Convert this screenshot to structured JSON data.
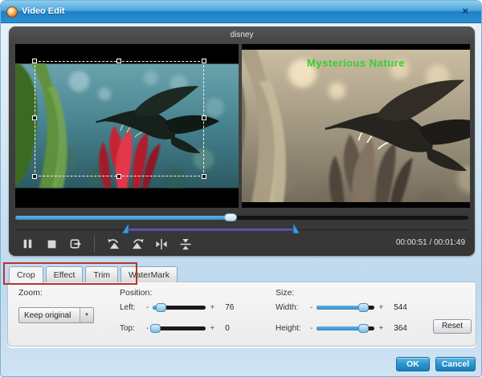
{
  "window": {
    "title": "Video Edit",
    "close_glyph": "×"
  },
  "stage": {
    "clip_name": "disney",
    "time_display": "00:00:51 / 00:01:49",
    "watermark_text": "Mysterious Nature"
  },
  "icons": {
    "app": "video-edit-app-icon",
    "pause": "pause-icon",
    "stop": "stop-icon",
    "snapshot": "snapshot-icon",
    "rotate_left": "rotate-left-icon",
    "rotate_right": "rotate-right-icon",
    "flip_horizontal": "flip-horizontal-icon",
    "flip_vertical": "flip-vertical-icon",
    "dropdown_arrow": "▼"
  },
  "tabs": {
    "items": [
      {
        "label": "Crop",
        "active": true
      },
      {
        "label": "Effect",
        "active": false
      },
      {
        "label": "Trim",
        "active": false
      },
      {
        "label": "WaterMark",
        "active": false
      }
    ]
  },
  "controls": {
    "zoom": {
      "label": "Zoom:",
      "selected": "Keep original"
    },
    "position": {
      "label": "Position:",
      "left": {
        "label": "Left:",
        "minus": "-",
        "plus": "+",
        "value": "76"
      },
      "top": {
        "label": "Top:",
        "minus": "-",
        "plus": "+",
        "value": "0"
      }
    },
    "size": {
      "label": "Size:",
      "width": {
        "label": "Width:",
        "minus": "-",
        "plus": "+",
        "value": "544"
      },
      "height": {
        "label": "Height:",
        "minus": "-",
        "plus": "+",
        "value": "364"
      }
    },
    "reset_label": "Reset"
  },
  "footer": {
    "ok_label": "OK",
    "cancel_label": "Cancel"
  },
  "colors": {
    "titlebar_top": "#6cbce9",
    "titlebar_bottom": "#1e81c4",
    "accent_blue": "#2f93cc",
    "stage_bg": "#404040",
    "watermark_green": "#2fd32f",
    "annotation_red": "#b5342c",
    "trim_purple": "#5a4fa8"
  }
}
